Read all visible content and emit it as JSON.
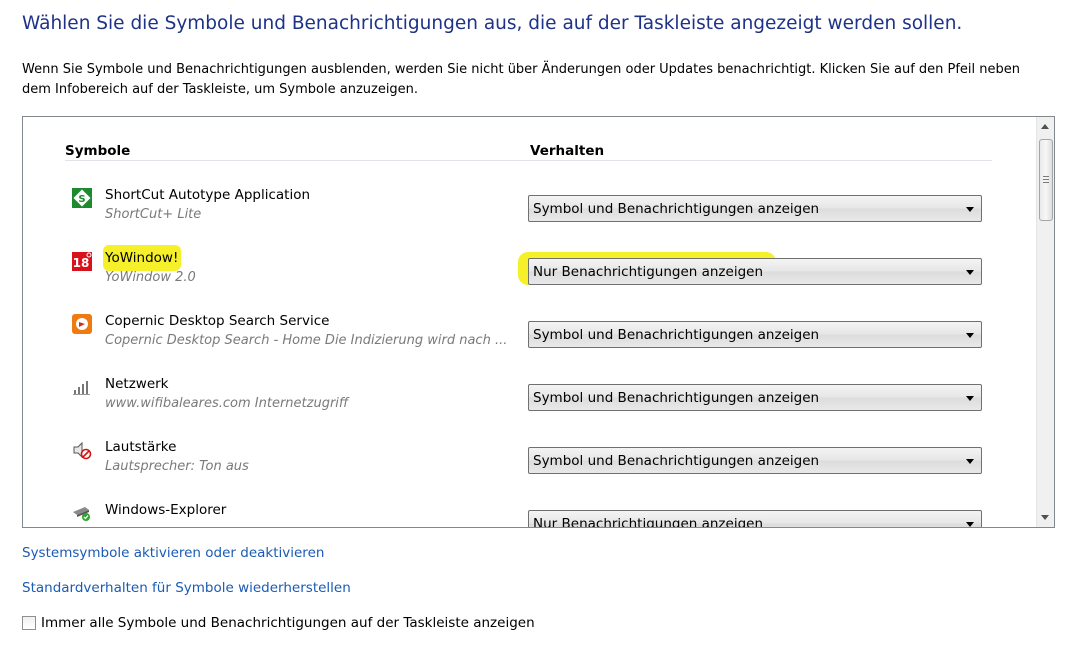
{
  "header": {
    "title": "Wählen Sie die Symbole und Benachrichtigungen aus, die auf der Taskleiste angezeigt werden sollen.",
    "description": "Wenn Sie Symbole und Benachrichtigungen ausblenden, werden Sie nicht über Änderungen oder Updates benachrichtigt. Klicken Sie auf den Pfeil neben dem Infobereich auf der Taskleiste, um Symbole anzuzeigen."
  },
  "table": {
    "col_symbols": "Symbole",
    "col_behavior": "Verhalten",
    "rows": [
      {
        "name": "ShortCut Autotype Application",
        "sub": "ShortCut+ Lite",
        "behavior": "Symbol und Benachrichtigungen anzeigen",
        "icon": "shortcut-app-icon",
        "highlighted": false
      },
      {
        "name": "YoWindow!",
        "sub": "YoWindow 2.0",
        "behavior": "Nur Benachrichtigungen anzeigen",
        "icon": "yowindow-icon",
        "highlighted": true
      },
      {
        "name": "Copernic Desktop Search Service",
        "sub": "Copernic Desktop Search - Home  Die Indizierung wird nach ...",
        "behavior": "Symbol und Benachrichtigungen anzeigen",
        "icon": "copernic-icon",
        "highlighted": false
      },
      {
        "name": "Netzwerk",
        "sub": "www.wifibaleares.com Internetzugriff",
        "behavior": "Symbol und Benachrichtigungen anzeigen",
        "icon": "network-icon",
        "highlighted": false
      },
      {
        "name": "Lautstärke",
        "sub": "Lautsprecher: Ton aus",
        "behavior": "Symbol und Benachrichtigungen anzeigen",
        "icon": "volume-muted-icon",
        "highlighted": false
      },
      {
        "name": "Windows-Explorer",
        "sub": "",
        "behavior": "Nur Benachrichtigungen anzeigen",
        "icon": "windows-explorer-icon",
        "highlighted": false
      }
    ]
  },
  "links": {
    "system_icons": "Systemsymbole aktivieren oder deaktivieren",
    "restore_defaults": "Standardverhalten für Symbole wiederherstellen"
  },
  "always_show": {
    "label": "Immer alle Symbole und Benachrichtigungen auf der Taskleiste anzeigen",
    "checked": false
  },
  "colors": {
    "title": "#1e3287",
    "link": "#1a5bb4",
    "highlight": "#f5f02a"
  }
}
